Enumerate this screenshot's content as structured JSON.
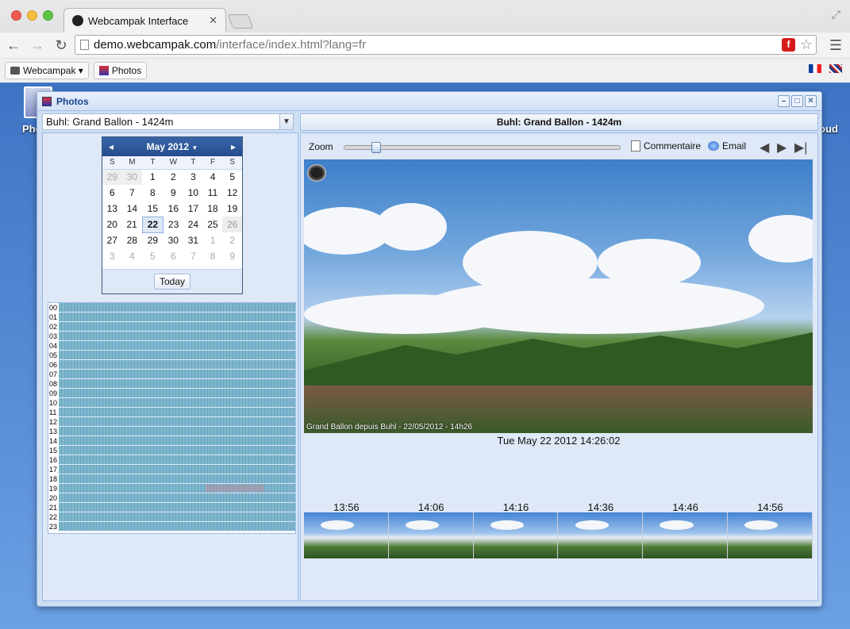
{
  "browser": {
    "tab_title": "Webcampak Interface",
    "tab_close": "✕",
    "url_host": "demo.webcampak.com",
    "url_path": "/interface/index.html?lang=fr",
    "bookmarks": [
      {
        "label": "Webcampak ▾"
      },
      {
        "label": "Photos"
      }
    ]
  },
  "desktop": {
    "left_label": "Phc",
    "right_label": "oud"
  },
  "window": {
    "title": "Photos",
    "source_select": "Buhl: Grand Ballon - 1424m",
    "header_title": "Buhl: Grand Ballon - 1424m"
  },
  "calendar": {
    "month_label": "May 2012",
    "days_of_week": [
      "S",
      "M",
      "T",
      "W",
      "T",
      "F",
      "S"
    ],
    "weeks": [
      [
        "29",
        "30",
        "1",
        "2",
        "3",
        "4",
        "5"
      ],
      [
        "6",
        "7",
        "8",
        "9",
        "10",
        "11",
        "12"
      ],
      [
        "13",
        "14",
        "15",
        "16",
        "17",
        "18",
        "19"
      ],
      [
        "20",
        "21",
        "22",
        "23",
        "24",
        "25",
        "26"
      ],
      [
        "27",
        "28",
        "29",
        "30",
        "31",
        "1",
        "2"
      ],
      [
        "3",
        "4",
        "5",
        "6",
        "7",
        "8",
        "9"
      ]
    ],
    "today_label": "Today"
  },
  "hours": [
    "00",
    "01",
    "02",
    "03",
    "04",
    "05",
    "06",
    "07",
    "08",
    "09",
    "10",
    "11",
    "12",
    "13",
    "14",
    "15",
    "16",
    "17",
    "18",
    "19",
    "20",
    "21",
    "22",
    "23"
  ],
  "toolbar": {
    "zoom_label": "Zoom",
    "comment_label": "Commentaire",
    "email_label": "Email"
  },
  "photo": {
    "caption": "Grand Ballon depuis Buhl - 22/05/2012 - 14h26",
    "timestamp": "Tue May 22 2012 14:26:02"
  },
  "thumbnails": [
    "13:56",
    "14:06",
    "14:16",
    "14:36",
    "14:46",
    "14:56"
  ]
}
